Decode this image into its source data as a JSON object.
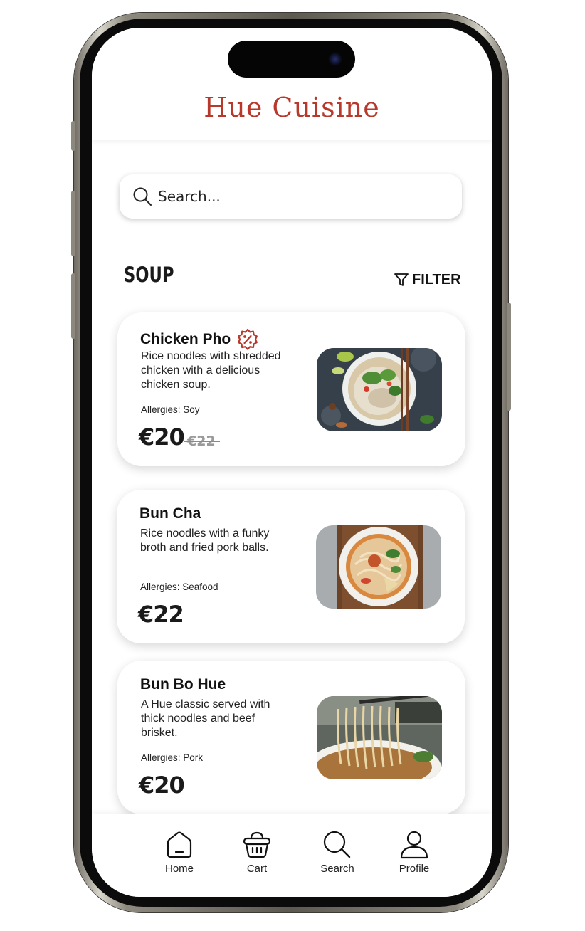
{
  "app": {
    "title": "Hue Cuisine"
  },
  "search": {
    "placeholder": "Search..."
  },
  "section": {
    "title": "SOUP",
    "filter_label": "FILTER"
  },
  "menu": [
    {
      "name": "Chicken Pho",
      "description": "Rice noodles with shredded chicken with a delicious chicken soup.",
      "allergies": "Allergies: Soy",
      "price": "€20",
      "old_price": "€22",
      "badge_icon": "discount-badge-icon"
    },
    {
      "name": "Bun Cha",
      "description": "Rice noodles with a funky broth and fried pork balls.",
      "allergies": "Allergies: Seafood",
      "price": "€22"
    },
    {
      "name": "Bun Bo Hue",
      "description": "A Hue classic served with thick noodles and beef brisket.",
      "allergies": "Allergies: Pork",
      "price": "€20"
    }
  ],
  "nav": [
    {
      "label": "Home",
      "icon": "home-icon"
    },
    {
      "label": "Cart",
      "icon": "basket-icon"
    },
    {
      "label": "Search",
      "icon": "search-icon"
    },
    {
      "label": "Profile",
      "icon": "user-icon"
    }
  ],
  "colors": {
    "brand": "#b8392b",
    "text": "#1a1a1a",
    "old_price": "#9a9a9a"
  }
}
